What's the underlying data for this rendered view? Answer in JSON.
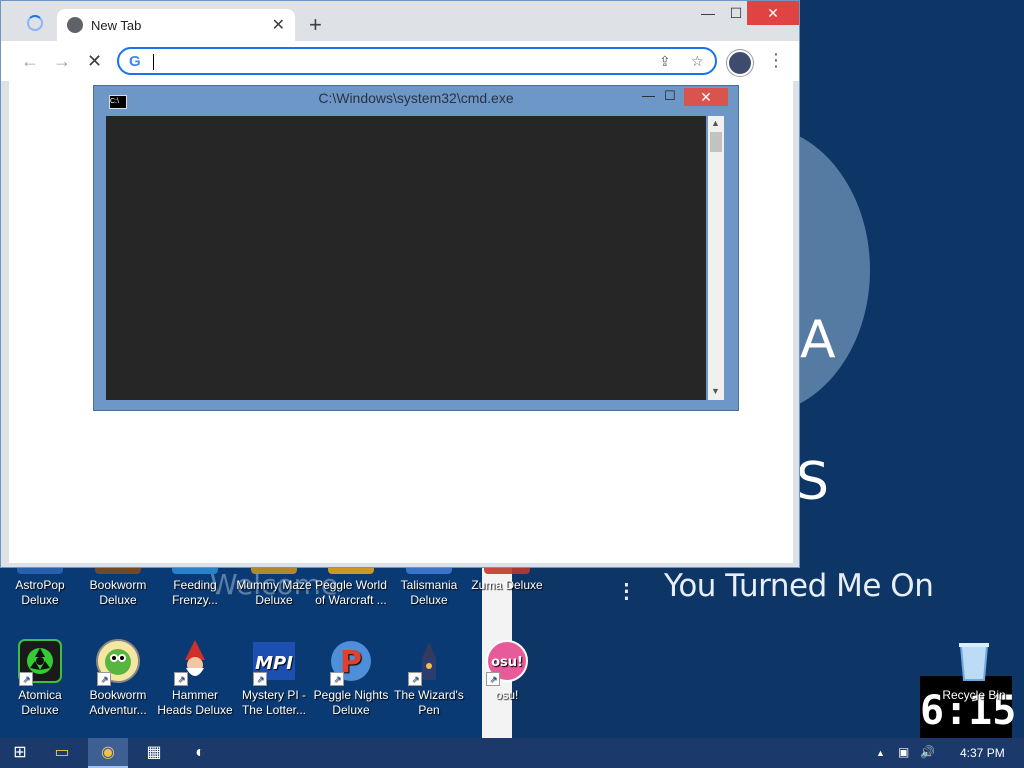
{
  "browser": {
    "tab_title": "New Tab",
    "new_tab": "+",
    "close_tab": "✕",
    "back": "←",
    "forward": "→",
    "stop": "✕",
    "omnibox_value": "",
    "g_logo": "G",
    "share": "⇪",
    "bookmark": "☆",
    "menu": "⋮",
    "minimize": "—",
    "maximize": "☐",
    "close": "✕"
  },
  "cmd": {
    "title": "C:\\Windows\\system32\\cmd.exe",
    "minimize": "—",
    "maximize": "☐",
    "close": "✕",
    "icon_text": "C:\\",
    "scroll_up": "▲",
    "scroll_down": "▼"
  },
  "wallpaper": {
    "tagline": "You Turned Me On",
    "welcome": "Welcome",
    "letter_a": "A",
    "letter_s": "S",
    "dot": "⁝",
    "clock": "6:15"
  },
  "icons": [
    {
      "label": "AstroPop Deluxe",
      "color": "#2a66b4"
    },
    {
      "label": "Bookworm Deluxe",
      "color": "#7b4c1e"
    },
    {
      "label": "Feeding Frenzy...",
      "color": "#2c8ad1"
    },
    {
      "label": "Mummy Maze Deluxe",
      "color": "#c2912b"
    },
    {
      "label": "Peggle World of Warcraft ...",
      "color": "#e2a121"
    },
    {
      "label": "Talismania Deluxe",
      "color": "#3e7bd1"
    },
    {
      "label": "Zuma Deluxe",
      "color": "#c0392b"
    },
    {
      "label": "Atomica Deluxe",
      "color": "#2fa43b"
    },
    {
      "label": "Bookworm Adventur...",
      "color": "#5aa32b"
    },
    {
      "label": "Hammer Heads Deluxe",
      "color": "#c0392b"
    },
    {
      "label": "Mystery PI - The Lotter...",
      "color": "#1d4fb3"
    },
    {
      "label": "Peggle Nights Deluxe",
      "color": "#d8432c"
    },
    {
      "label": "The Wizard's Pen",
      "color": "#2b3d6e"
    },
    {
      "label": "osu!",
      "color": "#e85b9a"
    },
    {
      "label": "Recycle Bin",
      "color": "#6fa9dd"
    }
  ],
  "taskbar": {
    "start": "⊞",
    "explorer": "▭",
    "chrome": "◉",
    "app1": "▦",
    "app2": "◐",
    "tray_up": "▲",
    "network": "▣",
    "volume": "🔊",
    "time": "4:37 PM"
  }
}
